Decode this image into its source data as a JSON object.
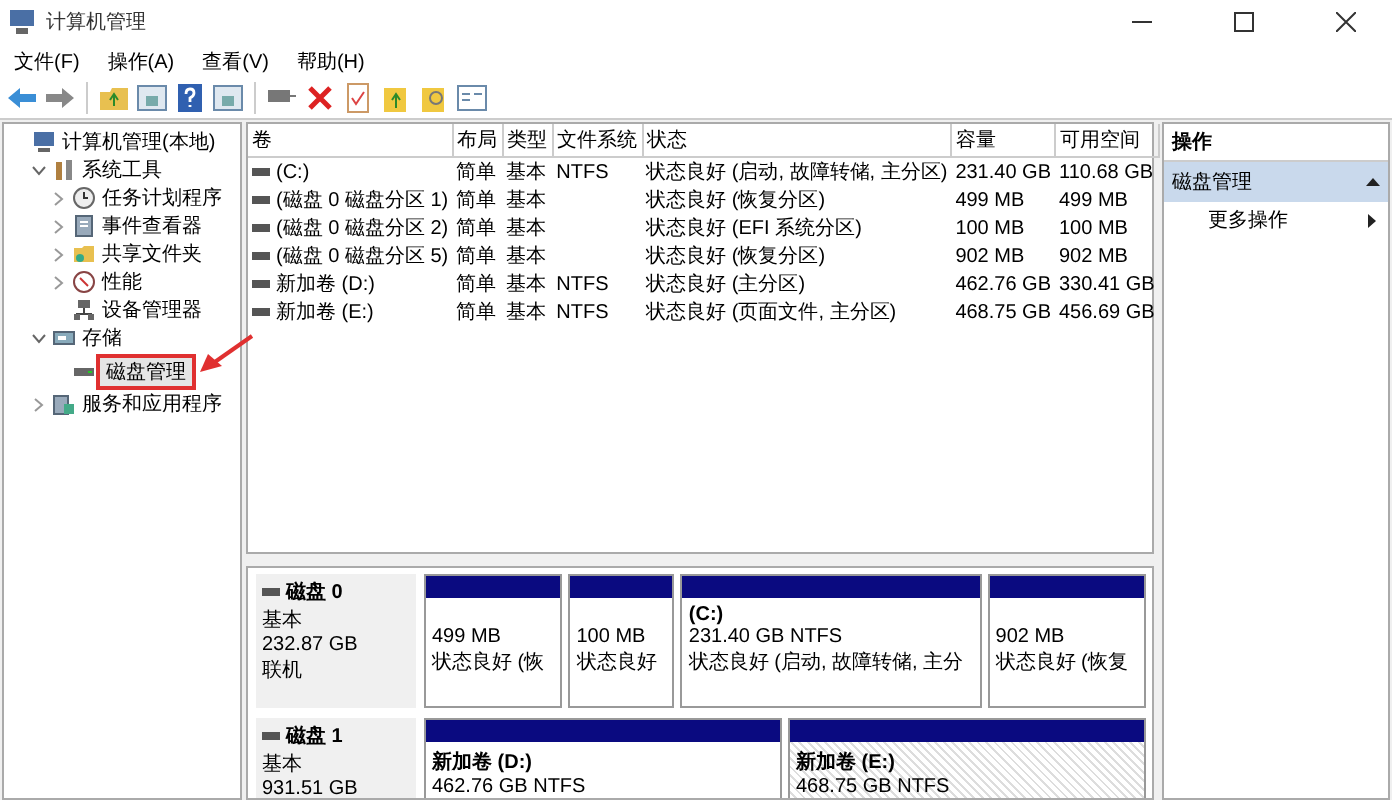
{
  "window": {
    "title": "计算机管理"
  },
  "menu": [
    "文件(F)",
    "操作(A)",
    "查看(V)",
    "帮助(H)"
  ],
  "tree": [
    {
      "label": "计算机管理(本地)",
      "selected": false,
      "children": [
        {
          "label": "系统工具",
          "expanded": true,
          "selected": false,
          "children": [
            {
              "label": "任务计划程序",
              "expanded": false,
              "selected": false
            },
            {
              "label": "事件查看器",
              "expanded": false,
              "selected": false
            },
            {
              "label": "共享文件夹",
              "expanded": false,
              "selected": false
            },
            {
              "label": "性能",
              "expanded": false,
              "selected": false
            },
            {
              "label": "设备管理器",
              "selected": false
            }
          ]
        },
        {
          "label": "存储",
          "expanded": true,
          "selected": false,
          "children": [
            {
              "label": "磁盘管理",
              "selected": true
            }
          ]
        },
        {
          "label": "服务和应用程序",
          "expanded": false,
          "selected": false
        }
      ]
    }
  ],
  "table": {
    "columns": [
      "卷",
      "布局",
      "类型",
      "文件系统",
      "状态",
      "容量",
      "可用空间"
    ],
    "rows": [
      [
        "(C:)",
        "简单",
        "基本",
        "NTFS",
        "状态良好 (启动, 故障转储, 主分区)",
        "231.40 GB",
        "110.68 GB"
      ],
      [
        "(磁盘 0 磁盘分区 1)",
        "简单",
        "基本",
        "",
        "状态良好 (恢复分区)",
        "499 MB",
        "499 MB"
      ],
      [
        "(磁盘 0 磁盘分区 2)",
        "简单",
        "基本",
        "",
        "状态良好 (EFI 系统分区)",
        "100 MB",
        "100 MB"
      ],
      [
        "(磁盘 0 磁盘分区 5)",
        "简单",
        "基本",
        "",
        "状态良好 (恢复分区)",
        "902 MB",
        "902 MB"
      ],
      [
        "新加卷 (D:)",
        "简单",
        "基本",
        "NTFS",
        "状态良好 (主分区)",
        "462.76 GB",
        "330.41 GB"
      ],
      [
        "新加卷 (E:)",
        "简单",
        "基本",
        "NTFS",
        "状态良好 (页面文件, 主分区)",
        "468.75 GB",
        "456.69 GB"
      ]
    ]
  },
  "disks": [
    {
      "name": "磁盘 0",
      "lines": [
        "基本",
        "232.87 GB",
        "联机"
      ],
      "partitions": [
        {
          "size": "499 MB",
          "status": "状态良好 (恢",
          "selected": false
        },
        {
          "size": "100 MB",
          "status": "状态良好",
          "selected": false
        },
        {
          "label": "(C:)",
          "size": "231.40 GB NTFS",
          "status": "状态良好 (启动, 故障转储, 主分",
          "selected": false
        },
        {
          "size": "902 MB",
          "status": "状态良好 (恢复",
          "selected": false
        }
      ]
    },
    {
      "name": "磁盘 1",
      "lines": [
        "基本",
        "931.51 GB"
      ],
      "partitions": [
        {
          "label": "新加卷 (D:)",
          "size": "462.76 GB NTFS",
          "selected": false
        },
        {
          "label": "新加卷 (E:)",
          "size": "468.75 GB NTFS",
          "selected": true
        }
      ]
    }
  ],
  "actions": {
    "header": "操作",
    "section": "磁盘管理",
    "items": [
      "更多操作"
    ]
  }
}
